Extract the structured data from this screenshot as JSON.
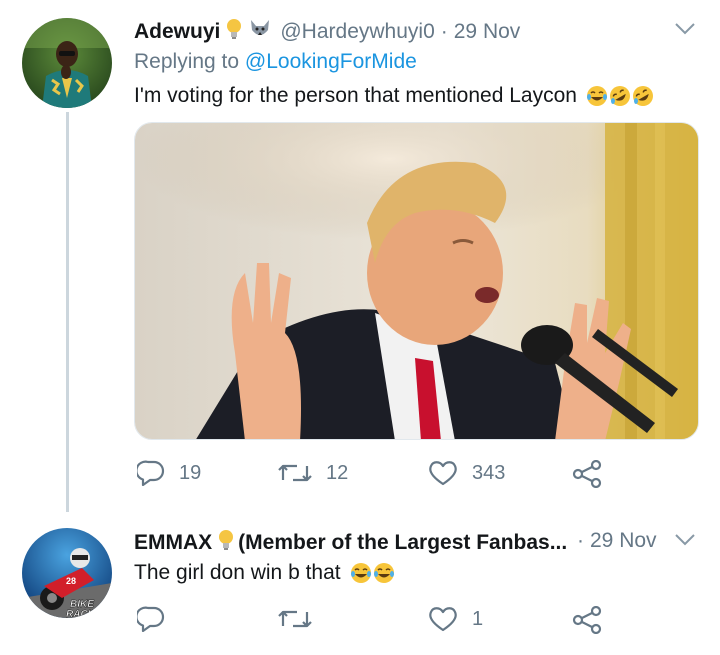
{
  "tweet1": {
    "name": "Adewuyi",
    "handle": "@Hardeywhuyi0",
    "dot": "·",
    "time": "29 Nov",
    "replying_prefix": "Replying to",
    "replying_to": "@LookingForMide",
    "text": "I'm voting for the person that mentioned Laycon",
    "replies": "19",
    "retweets": "12",
    "likes": "343"
  },
  "tweet2": {
    "name": "EMMAX",
    "name_suffix": "(Member of the Largest Fanbas...",
    "dot": "·",
    "time": "29 Nov",
    "text": "The girl don win b that",
    "replies": "",
    "retweets": "",
    "likes": "1",
    "avatar_text_line1": "BIKE",
    "avatar_text_line2": "RACING"
  },
  "colors": {
    "accent": "#1b95e0",
    "secondary_text": "#657786",
    "thread_line": "#ccd6dd"
  }
}
